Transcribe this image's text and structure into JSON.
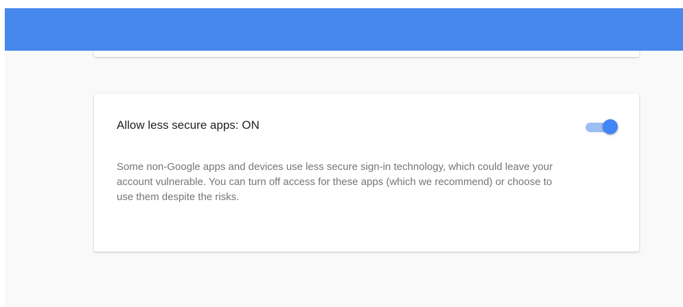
{
  "colors": {
    "header_bar": "#4688eb",
    "background": "#f9f9f9",
    "card": "#ffffff",
    "toggle_on": "#4285f4",
    "toggle_track_on": "#9fbef3",
    "title_text": "#212121",
    "body_text": "#757575"
  },
  "setting": {
    "title": "Allow less secure apps: ON",
    "description": "Some non-Google apps and devices use less secure sign-in technology, which could leave your account vulnerable. You can turn off access for these apps (which we recommend) or choose to use them despite the risks.",
    "toggle_state": "on"
  }
}
